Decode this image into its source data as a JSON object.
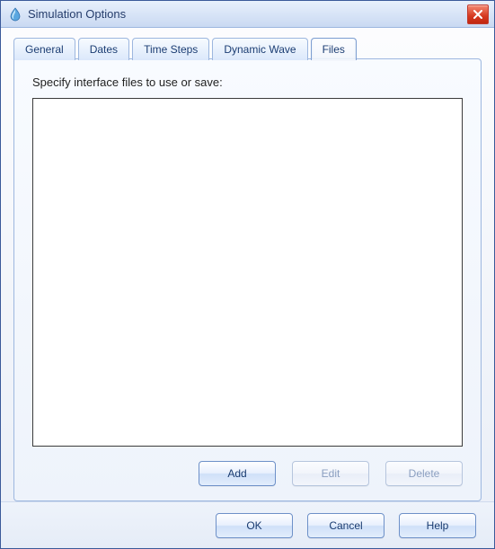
{
  "window": {
    "title": "Simulation Options"
  },
  "tabs": {
    "general": "General",
    "dates": "Dates",
    "timesteps": "Time Steps",
    "dynamicwave": "Dynamic Wave",
    "files": "Files",
    "active": "files"
  },
  "files_panel": {
    "label": "Specify interface files to use or save:",
    "items": [],
    "buttons": {
      "add": "Add",
      "edit": "Edit",
      "delete": "Delete"
    }
  },
  "footer": {
    "ok": "OK",
    "cancel": "Cancel",
    "help": "Help"
  }
}
